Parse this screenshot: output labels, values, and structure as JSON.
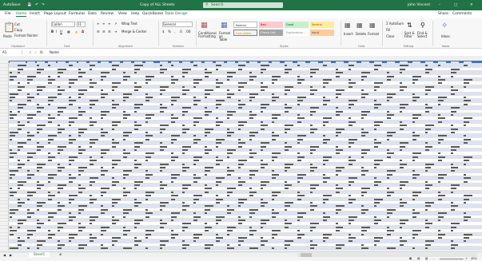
{
  "titlebar": {
    "autosave": "AutoSave",
    "filename": "Copy of ALL Sheets",
    "search_placeholder": "Search",
    "user": "John Vincent"
  },
  "tabs": [
    "File",
    "Home",
    "Insert",
    "Page Layout",
    "Formulas",
    "Data",
    "Review",
    "View",
    "Help",
    "QuickBooks",
    "Table Design"
  ],
  "share": "Share",
  "comments": "Comments",
  "ribbon": {
    "paste": "Paste",
    "cut": "Cut",
    "copy": "Copy",
    "format_painter": "Format Painter",
    "font_name": "Calibri",
    "font_size": "11",
    "wrap_text": "Wrap Text",
    "merge_center": "Merge & Center",
    "number_format": "General",
    "conditional_formatting": "Conditional Formatting",
    "format_as_table": "Format as Table",
    "styles": [
      "Normal",
      "Bad",
      "Good",
      "Neutral",
      "Calculation",
      "Check Cell",
      "Explanatory...",
      "Input"
    ],
    "insert": "Insert",
    "delete": "Delete",
    "format": "Format",
    "autosum": "AutoSum",
    "fill": "Fill",
    "clear": "Clear",
    "sort_filter": "Sort & Filter",
    "find_select": "Find & Select",
    "ideas": "Ideas",
    "groups": [
      "Clipboard",
      "Font",
      "Alignment",
      "Number",
      "Styles",
      "Cells",
      "Editing",
      "Ideas"
    ]
  },
  "formula_bar": {
    "name_box": "A1",
    "fx": "fx",
    "value": "Name"
  },
  "sheet_tab": "Sheet1",
  "status": {
    "zoom": "40%"
  },
  "colors": {
    "excel_green": "#217346",
    "table_header": "#4472c4",
    "band": "#dbe3f3"
  }
}
